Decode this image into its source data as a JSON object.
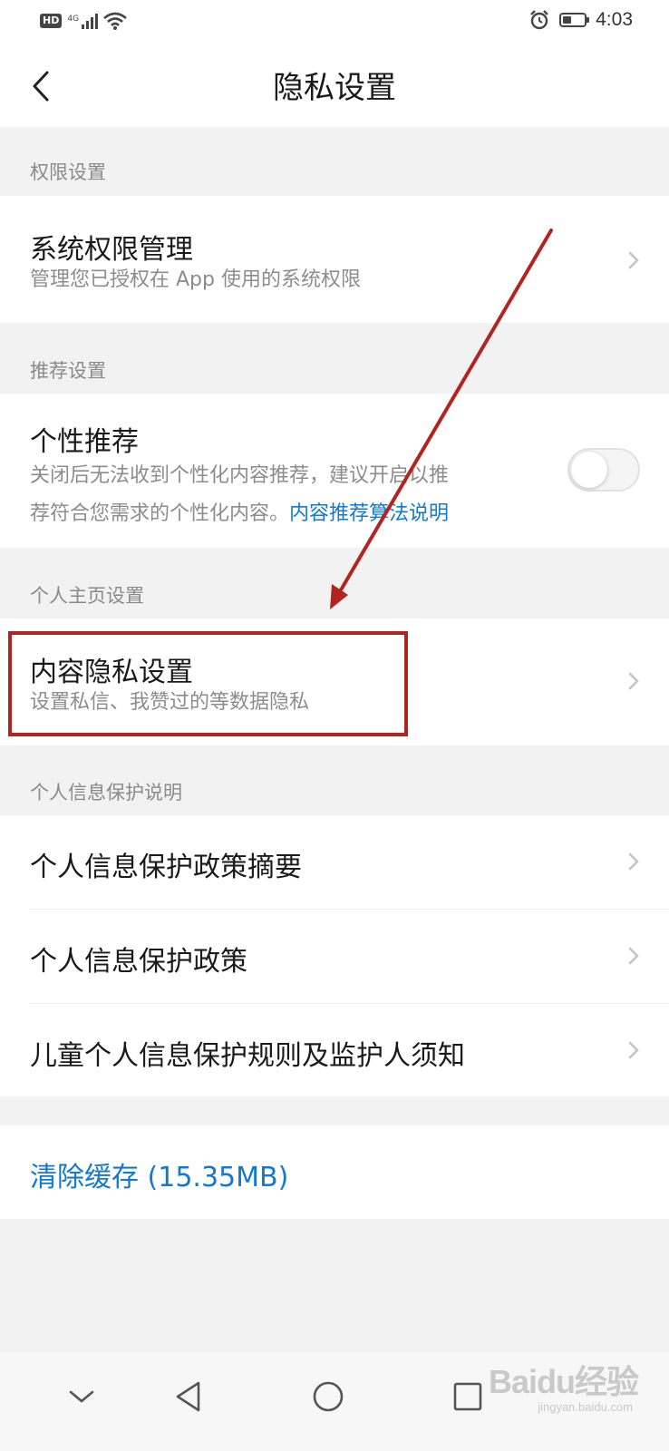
{
  "status_bar": {
    "hd": "HD",
    "network": "4G",
    "time": "4:03",
    "battery_level": 0.4
  },
  "header": {
    "title": "隐私设置"
  },
  "sections": {
    "permissions": {
      "label": "权限设置",
      "item_title": "系统权限管理",
      "item_sub": "管理您已授权在 App 使用的系统权限"
    },
    "recommend": {
      "label": "推荐设置",
      "item_title": "个性推荐",
      "item_sub_line1": "关闭后无法收到个性化内容推荐，建议开启以推",
      "item_sub_line2": "荐符合您需求的个性化内容。",
      "item_link": "内容推荐算法说明",
      "toggle_on": false
    },
    "homepage": {
      "label": "个人主页设置",
      "item_title": "内容隐私设置",
      "item_sub": "设置私信、我赞过的等数据隐私"
    },
    "info_protection": {
      "label": "个人信息保护说明",
      "items": [
        {
          "title": "个人信息保护政策摘要"
        },
        {
          "title": "个人信息保护政策"
        },
        {
          "title": "儿童个人信息保护规则及监护人须知"
        }
      ]
    }
  },
  "clear_cache": "清除缓存 (15.35MB)",
  "watermark": "Baidu经验",
  "watermark_sub": "jingyan.baidu.com",
  "colors": {
    "accent_blue": "#1478d2",
    "annotation_red": "#b3231f"
  }
}
